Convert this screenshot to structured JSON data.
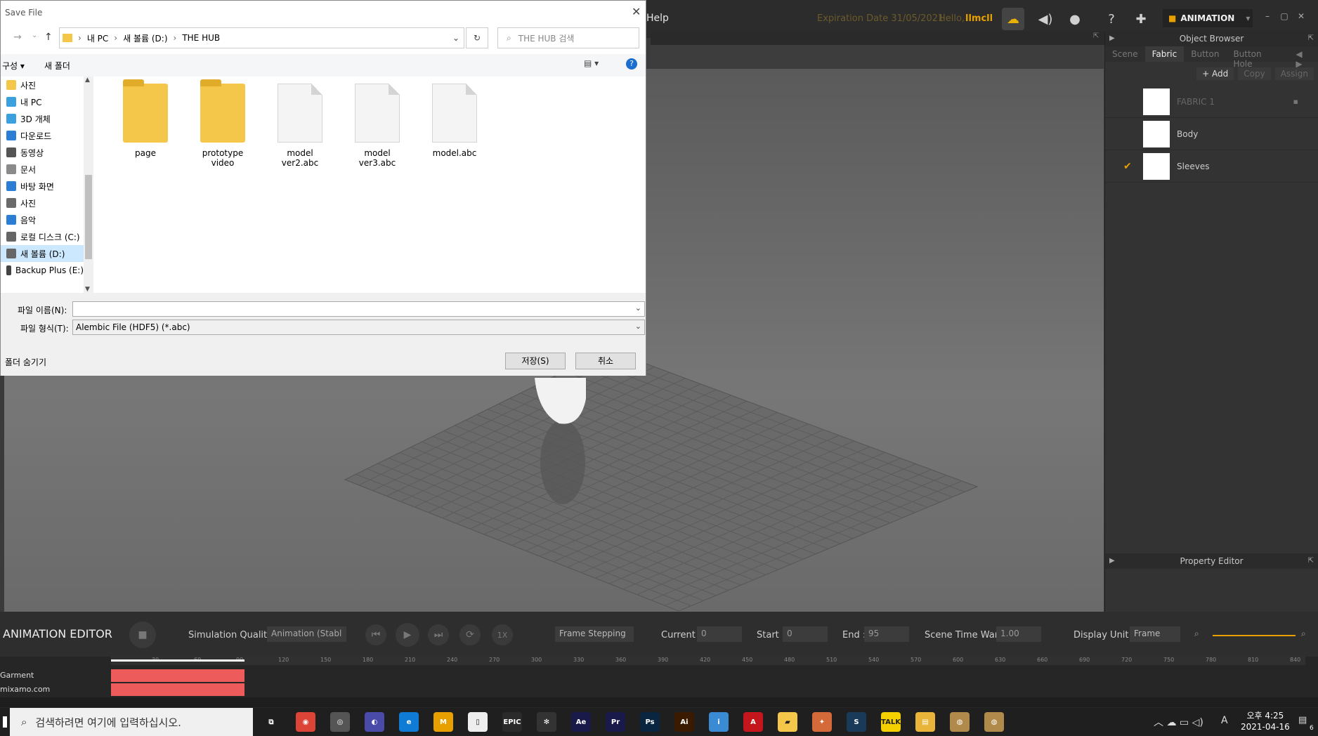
{
  "app": {
    "menu_help": "Help",
    "expiration": "Expiration Date 31/05/2021",
    "hello": "Hello,",
    "user": "llmcll",
    "mode": "ANIMATION",
    "icons": [
      "cloud-icon",
      "megaphone-icon",
      "user-icon",
      "help-icon",
      "settings-icon"
    ]
  },
  "object_browser": {
    "title": "Object Browser",
    "tabs": [
      "Scene",
      "Fabric",
      "Button",
      "Button Hole"
    ],
    "active_tab": "Fabric",
    "actions": {
      "add": "+ Add",
      "copy": "Copy",
      "assign": "Assign"
    },
    "fabrics": [
      {
        "name": "FABRIC 1",
        "checked": false,
        "dim": true
      },
      {
        "name": "Body",
        "checked": false,
        "dim": false
      },
      {
        "name": "Sleeves",
        "checked": true,
        "dim": false
      }
    ]
  },
  "property_editor": {
    "title": "Property Editor"
  },
  "anim_editor": {
    "title": "ANIMATION EDITOR",
    "sim_quality_label": "Simulation Quality",
    "sim_quality_value": "Animation (Stabl",
    "frame_stepping": "Frame Stepping",
    "current_label": "Current :",
    "current_value": "0",
    "start_label": "Start :",
    "start_value": "0",
    "end_label": "End :",
    "end_value": "95",
    "time_warp_label": "Scene Time Warp",
    "time_warp_value": "1.00",
    "display_unit_label": "Display Unit",
    "display_unit_value": "Frame",
    "speed_label": "1X"
  },
  "timeline": {
    "ticks": [
      "30",
      "60",
      "90",
      "120",
      "150",
      "180",
      "210",
      "240",
      "270",
      "300",
      "330",
      "360",
      "390",
      "420",
      "450",
      "480",
      "510",
      "540",
      "570",
      "600",
      "630",
      "660",
      "690",
      "720",
      "750",
      "780",
      "810",
      "840"
    ],
    "tracks": [
      "Garment",
      "mixamo.com"
    ]
  },
  "dialog": {
    "title": "Save File",
    "breadcrumb": [
      "내 PC",
      "새 볼륨 (D:)",
      "THE HUB"
    ],
    "search_placeholder": "THE HUB 검색",
    "organize": "구성",
    "new_folder": "새 폴더",
    "nav_items": [
      {
        "label": "사진",
        "color": "#f4c64a"
      },
      {
        "label": "내 PC",
        "color": "#3aa0e0"
      },
      {
        "label": "3D 개체",
        "color": "#3aa0e0"
      },
      {
        "label": "다운로드",
        "color": "#2a7fd4"
      },
      {
        "label": "동영상",
        "color": "#555555"
      },
      {
        "label": "문서",
        "color": "#8a8a8a"
      },
      {
        "label": "바탕 화면",
        "color": "#2a7fd4"
      },
      {
        "label": "사진",
        "color": "#6a6a6a"
      },
      {
        "label": "음악",
        "color": "#2a7fd4"
      },
      {
        "label": "로컬 디스크 (C:)",
        "color": "#666666"
      },
      {
        "label": "새 볼륨 (D:)",
        "color": "#666666"
      },
      {
        "label": "Backup Plus (E:)",
        "color": "#444444"
      }
    ],
    "selected_nav_index": 10,
    "files": [
      {
        "name": "page",
        "kind": "folder"
      },
      {
        "name": "prototype video",
        "kind": "folder"
      },
      {
        "name": "model ver2.abc",
        "kind": "doc"
      },
      {
        "name": "model ver3.abc",
        "kind": "doc"
      },
      {
        "name": "model.abc",
        "kind": "doc"
      }
    ],
    "filename_label": "파일 이름(N):",
    "filename_value": "",
    "filetype_label": "파일 형식(T):",
    "filetype_value": "Alembic File (HDF5) (*.abc)",
    "hide_folders": "폴더 숨기기",
    "save_button": "저장(S)",
    "cancel_button": "취소"
  },
  "taskbar": {
    "search_placeholder": "검색하려면 여기에 입력하십시오.",
    "apps": [
      {
        "name": "task-view",
        "label": "⧉",
        "color": "#1f1f1f"
      },
      {
        "name": "chrome",
        "label": "◉",
        "color": "#db4437"
      },
      {
        "name": "search-app",
        "label": "◎",
        "color": "#555555"
      },
      {
        "name": "browser",
        "label": "◐",
        "color": "#4a4aa8"
      },
      {
        "name": "edge",
        "label": "e",
        "color": "#0f7bd4"
      },
      {
        "name": "maya",
        "label": "M",
        "color": "#e8a000"
      },
      {
        "name": "notepad",
        "label": "▯",
        "color": "#eeeeee"
      },
      {
        "name": "epic",
        "label": "EPIC",
        "color": "#2a2a2a"
      },
      {
        "name": "davinci",
        "label": "✻",
        "color": "#333333"
      },
      {
        "name": "after-effects",
        "label": "Ae",
        "color": "#1a1a4a"
      },
      {
        "name": "premiere",
        "label": "Pr",
        "color": "#1a1a4a"
      },
      {
        "name": "photoshop",
        "label": "Ps",
        "color": "#0a2540"
      },
      {
        "name": "illustrator",
        "label": "Ai",
        "color": "#3a1a00"
      },
      {
        "name": "info-app",
        "label": "i",
        "color": "#3a8ad4"
      },
      {
        "name": "acrobat",
        "label": "A",
        "color": "#c4161c"
      },
      {
        "name": "sticky",
        "label": "▰",
        "color": "#f4c64a"
      },
      {
        "name": "marvelous",
        "label": "✦",
        "color": "#d46a3a"
      },
      {
        "name": "steam",
        "label": "S",
        "color": "#1a3a5a"
      },
      {
        "name": "kakao",
        "label": "TALK",
        "color": "#f4d000"
      },
      {
        "name": "explorer",
        "label": "▤",
        "color": "#e8b43a"
      },
      {
        "name": "chick1",
        "label": "◍",
        "color": "#b08a4a"
      },
      {
        "name": "chick2",
        "label": "◍",
        "color": "#b08a4a"
      }
    ],
    "time": "오후 4:25",
    "date": "2021-04-16",
    "ime": "A",
    "notif_count": "6"
  }
}
